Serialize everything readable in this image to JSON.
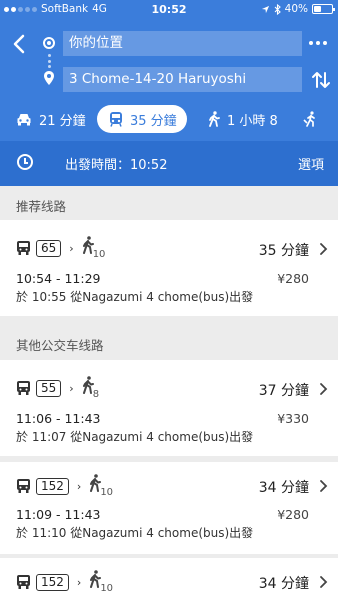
{
  "status_bar": {
    "carrier": "SoftBank",
    "network": "4G",
    "time": "10:52",
    "battery_pct": 40,
    "battery_text": "40%"
  },
  "header": {
    "origin": "你的位置",
    "destination": "3 Chome-14-20 Haruyoshi",
    "modes": [
      {
        "icon": "car-icon",
        "label": "21 分鐘"
      },
      {
        "icon": "transit-icon",
        "label": "35 分鐘",
        "selected": true
      },
      {
        "icon": "walk-icon",
        "label": "1 小時 8"
      },
      {
        "icon": "other-mode-icon",
        "label": ""
      }
    ],
    "depart_label": "出發時間：10:52",
    "options_label": "選項"
  },
  "sections": {
    "recommended": "推荐线路",
    "other": "其他公交车线路"
  },
  "routes": [
    {
      "bus": "65",
      "walk_min": "10",
      "duration": "35 分鐘",
      "times": "10:54 - 11:29",
      "price": "¥280",
      "detail": "於 10:55 從Nagazumi 4 chome(bus)出發"
    },
    {
      "bus": "55",
      "walk_min": "8",
      "duration": "37 分鐘",
      "times": "11:06 - 11:43",
      "price": "¥330",
      "detail": "於 11:07 從Nagazumi 4 chome(bus)出發"
    },
    {
      "bus": "152",
      "walk_min": "10",
      "duration": "34 分鐘",
      "times": "11:09 - 11:43",
      "price": "¥280",
      "detail": "於 11:10 從Nagazumi 4 chome(bus)出發"
    },
    {
      "bus": "152",
      "walk_min": "10",
      "duration": "34 分鐘"
    }
  ],
  "colors": {
    "header_blue": "#3b7ddb",
    "options_blue": "#2d6fcf",
    "background": "#ececec"
  }
}
